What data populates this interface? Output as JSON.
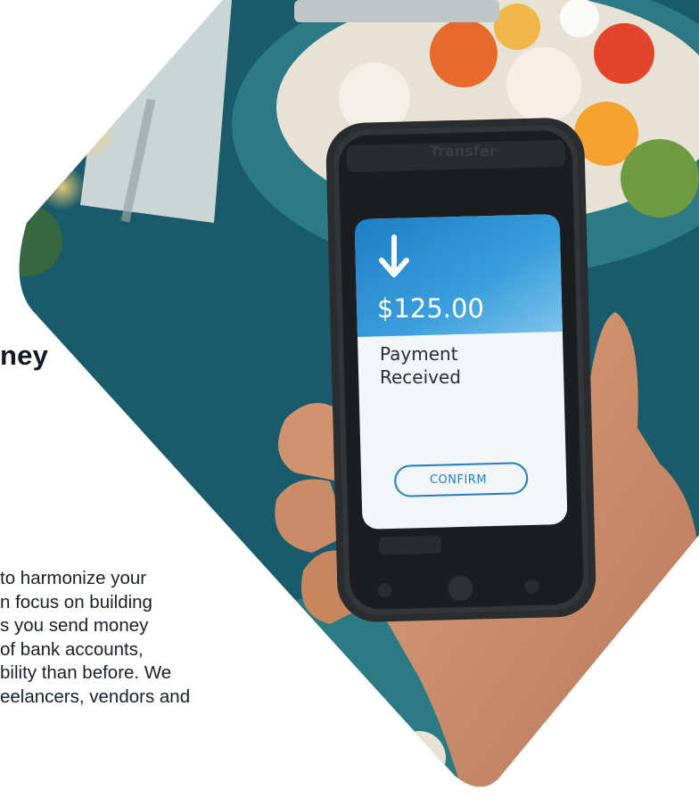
{
  "headline": "ney",
  "body_lines": [
    "to harmonize your",
    "n focus on building",
    "s you send money",
    "of bank accounts,",
    "bility than before. We",
    "eelancers, vendors and"
  ],
  "phone": {
    "title": "Transfer",
    "amount": "$125.00",
    "status_line1": "Payment",
    "status_line2": "Received",
    "confirm_label": "CONFIRM"
  },
  "colors": {
    "card_blue": "#2a8fd2",
    "confirm_blue": "#1f7fbf",
    "teal_bg": "#1e6170",
    "ink": "#12192b"
  },
  "icons": [
    "arrow-down-icon"
  ]
}
